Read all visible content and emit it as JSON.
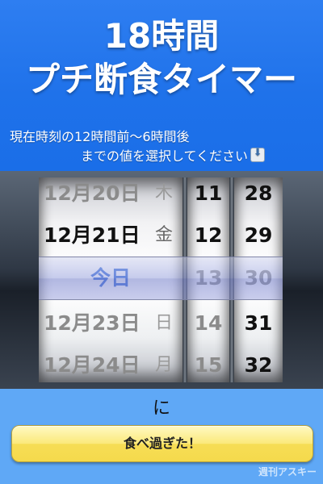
{
  "header": {
    "title_line1": "18時間",
    "title_line2": "プチ断食タイマー",
    "instruction_line1": "現在時刻の12時間前〜6時間後",
    "instruction_line2": "までの値を選択してください",
    "instruction_icon": "down-arrow-icon"
  },
  "picker": {
    "date_rows": [
      {
        "date": "12月20日",
        "weekday": "木"
      },
      {
        "date": "12月21日",
        "weekday": "金"
      },
      {
        "date": "今日",
        "weekday": ""
      },
      {
        "date": "12月23日",
        "weekday": "日"
      },
      {
        "date": "12月24日",
        "weekday": "月"
      }
    ],
    "hour_rows": [
      "11",
      "12",
      "13",
      "14",
      "15"
    ],
    "minute_rows": [
      "28",
      "29",
      "30",
      "31",
      "32"
    ],
    "selected": {
      "date": "今日",
      "hour": "13",
      "minute": "30"
    }
  },
  "connector_text": "に",
  "action_button_label": "食べ過ぎた！",
  "watermark": "週刊アスキー",
  "colors": {
    "header_blue": "#1f72ea",
    "background_blue": "#5fa8f6",
    "button_yellow": "#f6dd55",
    "selected_today_blue": "#2f66d9"
  }
}
